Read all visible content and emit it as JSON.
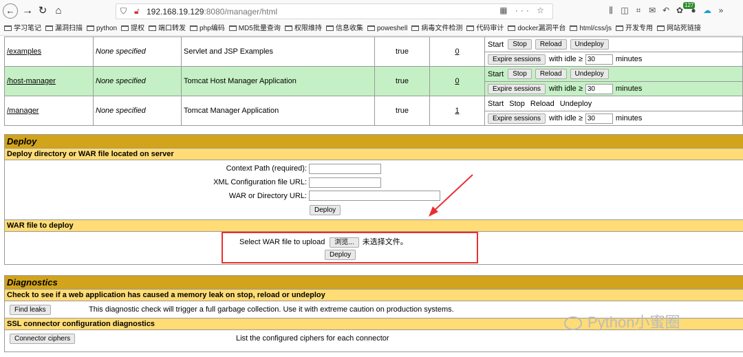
{
  "browser": {
    "url_host": "192.168.19.129",
    "url_rest": ":8080/manager/html",
    "badge": "127",
    "bookmarks": [
      "学习笔记",
      "漏洞扫描",
      "python",
      "提权",
      "端口转发",
      "php编码",
      "MD5批量查询",
      "权限维持",
      "信息收集",
      "poweshell",
      "病毒文件检测",
      "代码审计",
      "docker漏洞平台",
      "html/css/js",
      "开发专用",
      "网站死链接"
    ]
  },
  "apps": [
    {
      "path": "/examples",
      "version": "None specified",
      "display": "Servlet and JSP Examples",
      "running": "true",
      "sessions": "0",
      "highlight": false
    },
    {
      "path": "/host-manager",
      "version": "None specified",
      "display": "Tomcat Host Manager Application",
      "running": "true",
      "sessions": "0",
      "highlight": true
    },
    {
      "path": "/manager",
      "version": "None specified",
      "display": "Tomcat Manager Application",
      "running": "true",
      "sessions": "1",
      "highlight": false
    }
  ],
  "commands": {
    "start": "Start",
    "stop": "Stop",
    "reload": "Reload",
    "undeploy": "Undeploy",
    "expire": "Expire sessions",
    "with_idle": "with idle ≥",
    "idle_value": "30",
    "minutes": "minutes"
  },
  "deploy": {
    "title": "Deploy",
    "server_sub": "Deploy directory or WAR file located on server",
    "context_label": "Context Path (required):",
    "xml_label": "XML Configuration file URL:",
    "war_dir_label": "WAR or Directory URL:",
    "deploy_btn": "Deploy",
    "war_sub": "WAR file to deploy",
    "select_label": "Select WAR file to upload",
    "browse_btn": "浏览...",
    "no_file": "未选择文件。",
    "upload_deploy_btn": "Deploy"
  },
  "diagnostics": {
    "title": "Diagnostics",
    "leak_sub": "Check to see if a web application has caused a memory leak on stop, reload or undeploy",
    "find_leaks_btn": "Find leaks",
    "leak_desc": "This diagnostic check will trigger a full garbage collection. Use it with extreme caution on production systems.",
    "ssl_sub": "SSL connector configuration diagnostics",
    "ciphers_btn": "Connector ciphers",
    "ciphers_desc": "List the configured ciphers for each connector"
  },
  "watermark": "Python小蜜圈",
  "colors": {
    "section_title": "#d2a41c",
    "section_sub": "#ffdc75",
    "highlight_row": "#c5f0c5",
    "annotation": "#e83030"
  }
}
